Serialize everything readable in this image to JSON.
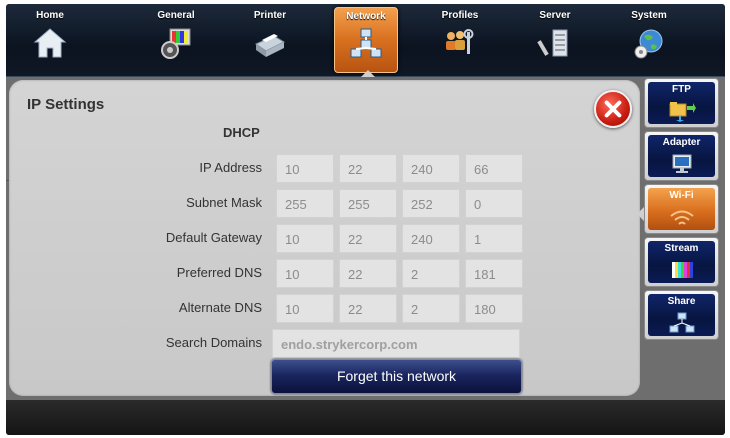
{
  "nav": {
    "items": [
      {
        "label": "Home",
        "icon": "home-icon"
      },
      {
        "label": "General",
        "icon": "general-settings-icon"
      },
      {
        "label": "Printer",
        "icon": "printer-icon"
      },
      {
        "label": "Network",
        "icon": "network-icon",
        "active": true
      },
      {
        "label": "Profiles",
        "icon": "profiles-icon"
      },
      {
        "label": "Server",
        "icon": "server-icon"
      },
      {
        "label": "System",
        "icon": "system-icon"
      }
    ]
  },
  "panel": {
    "title": "IP Settings",
    "mode_label": "DHCP",
    "rows": [
      {
        "label": "IP Address",
        "octets": [
          "10",
          "22",
          "240",
          "66"
        ]
      },
      {
        "label": "Subnet Mask",
        "octets": [
          "255",
          "255",
          "252",
          "0"
        ]
      },
      {
        "label": "Default Gateway",
        "octets": [
          "10",
          "22",
          "240",
          "1"
        ]
      },
      {
        "label": "Preferred DNS",
        "octets": [
          "10",
          "22",
          "2",
          "181"
        ]
      },
      {
        "label": "Alternate DNS",
        "octets": [
          "10",
          "22",
          "2",
          "180"
        ]
      }
    ],
    "search_domains": {
      "label": "Search Domains",
      "value": "endo.strykercorp.com"
    },
    "forget_button": "Forget this network"
  },
  "side_tabs": [
    {
      "label": "FTP",
      "icon": "ftp-folder-icon"
    },
    {
      "label": "Adapter",
      "icon": "adapter-monitor-icon"
    },
    {
      "label": "Wi-Fi",
      "icon": "wifi-icon",
      "active": true
    },
    {
      "label": "Stream",
      "icon": "stream-color-bars-icon"
    },
    {
      "label": "Share",
      "icon": "share-network-icon"
    }
  ],
  "colors": {
    "accent_orange": "#d8701f",
    "nav_dark": "#0b1320",
    "panel_gray": "#cfcfcf",
    "close_red": "#c81c10",
    "button_navy": "#1b2660"
  }
}
